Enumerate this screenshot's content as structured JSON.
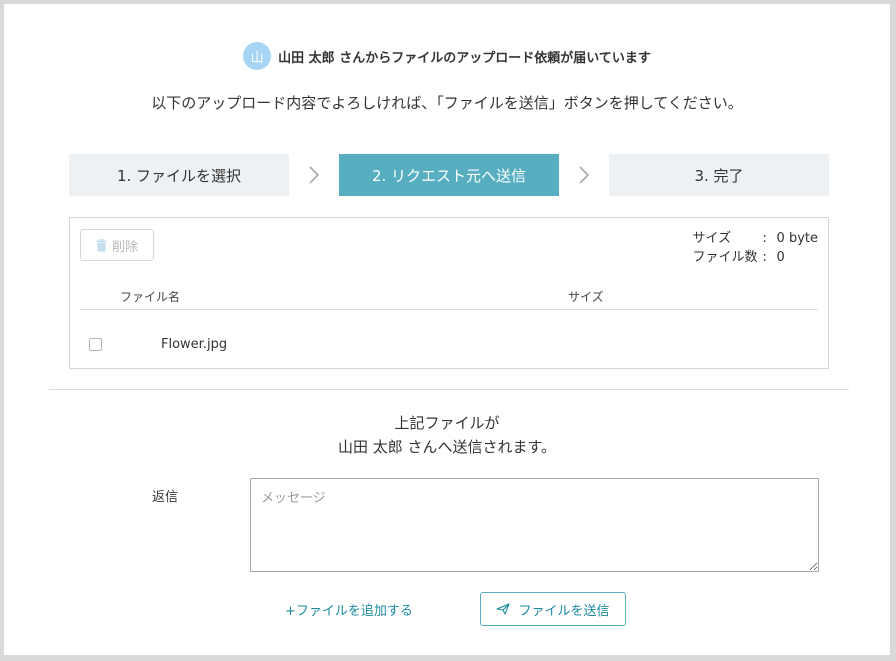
{
  "header": {
    "avatar_char": "山",
    "request_message": "山田 太郎 さんからファイルのアップロード依頼が届いています"
  },
  "instruction": "以下のアップロード内容でよろしければ、「ファイルを送信」ボタンを押してください。",
  "steps": [
    {
      "label": "1. ファイルを選択",
      "active": false
    },
    {
      "label": "2. リクエスト元へ送信",
      "active": true
    },
    {
      "label": "3. 完了",
      "active": false
    }
  ],
  "file_panel": {
    "delete_label": "削除",
    "summary": {
      "size_label": "サイズ",
      "size_value": "0 byte",
      "count_label": "ファイル数",
      "count_value": "0",
      "separator": ":"
    },
    "columns": {
      "name": "ファイル名",
      "size": "サイズ"
    },
    "files": [
      {
        "name": "Flower.jpg",
        "size": ""
      }
    ]
  },
  "notice": {
    "line1": "上記ファイルが",
    "line2": "山田 太郎 さんへ送信されます。"
  },
  "reply": {
    "label": "返信",
    "placeholder": "メッセージ"
  },
  "actions": {
    "add_file_label": "+ファイルを追加する",
    "send_label": "ファイルを送信"
  },
  "colors": {
    "accent": "#56aec0",
    "link": "#1b8aa0",
    "step_inactive_bg": "#eef1f4",
    "avatar_bg": "#a6d4f2"
  },
  "icons": {
    "delete": "trash-icon",
    "send": "paper-plane-icon",
    "step_separator": "chevron-right-icon"
  }
}
